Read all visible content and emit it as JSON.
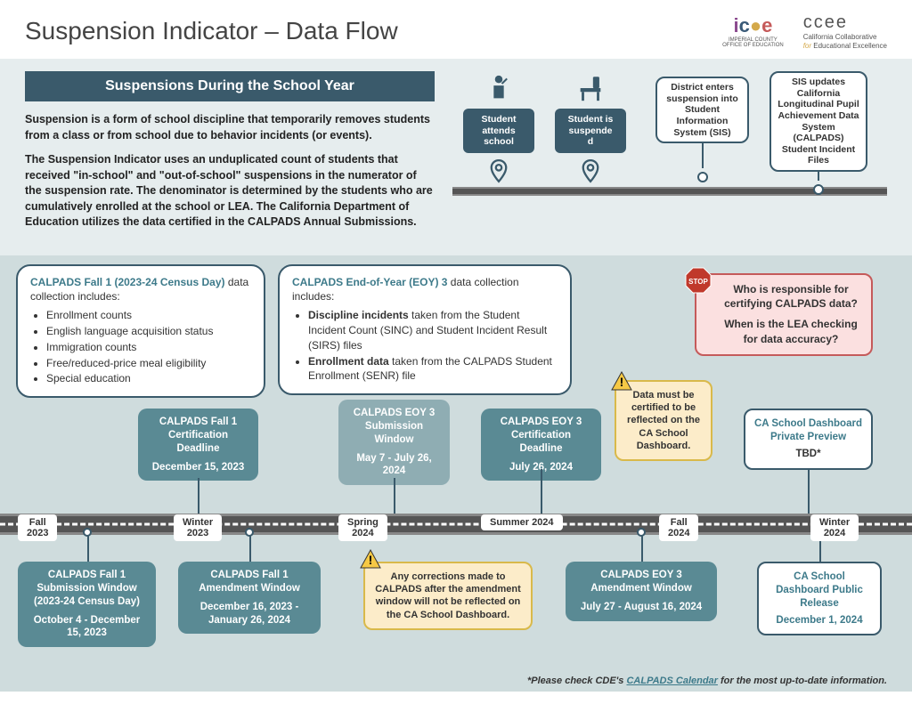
{
  "title": "Suspension Indicator – Data Flow",
  "logos": {
    "icoe_sub": "IMPERIAL COUNTY\nOFFICE OF EDUCATION",
    "ccee_top": "ccee",
    "ccee_sub1": "California Collaborative",
    "ccee_sub2_for": "for",
    "ccee_sub2_rest": " Educational Excellence"
  },
  "banner": "Suspensions During the School Year",
  "para1": "Suspension is a form of school discipline that temporarily removes students from a class or from school due to behavior incidents (or events).",
  "para2": "The Suspension Indicator uses an unduplicated count of students that received \"in-school\" and \"out-of-school\" suspensions in the numerator of the suspension rate. The denominator is determined by the students who are cumulatively enrolled at the school or LEA. The California Department of Education utilizes the data certified in the CALPADS Annual Submissions.",
  "mini": {
    "a": "Student attends school",
    "b": "Student is suspended",
    "c": "District enters suspension into Student Information System (SIS)",
    "d": "SIS updates California Longitudinal Pupil Achievement Data System (CALPADS) Student Incident Files"
  },
  "info1": {
    "hd": "CALPADS Fall 1 (2023-24 Census Day)",
    "tail": " data collection includes:",
    "items": [
      "Enrollment counts",
      "English language acquisition status",
      "Immigration counts",
      "Free/reduced-price meal eligibility",
      "Special education"
    ]
  },
  "info2": {
    "hd": "CALPADS End-of-Year (EOY) 3",
    "tail": " data collection includes:",
    "item1a": "Discipline incidents",
    "item1b": " taken from the Student Incident Count (SINC) and Student Incident Result (SIRS) files",
    "item2a": "Enrollment data",
    "item2b": " taken from the CALPADS Student Enrollment (SENR) file"
  },
  "stop": {
    "label": "STOP",
    "q1": "Who is responsible for certifying CALPADS data?",
    "q2": "When is the LEA checking for data accuracy?"
  },
  "alert_mid": "Data must be certified to be reflected on the\nCA School Dashboard.",
  "alert_low": "Any corrections made to CALPADS after the amendment window will not be reflected on the CA School Dashboard.",
  "seasons": [
    "Fall 2023",
    "Winter 2023",
    "Spring 2024",
    "Summer 2024",
    "Fall 2024",
    "Winter 2024"
  ],
  "boxes": {
    "fall1_cert": {
      "t": "CALPADS Fall 1 Certification Deadline",
      "d": "December 15, 2023"
    },
    "eoy3_win": {
      "t": "CALPADS EOY 3 Submission Window",
      "d": "May 7 - July 26, 2024"
    },
    "eoy3_cert": {
      "t": "CALPADS EOY 3 Certification Deadline",
      "d": "July 26, 2024"
    },
    "preview": {
      "t": "CA School Dashboard Private Preview",
      "d": "TBD*"
    },
    "fall1_sub": {
      "t": "CALPADS Fall 1 Submission Window (2023-24 Census Day)",
      "d": "October 4 - December 15, 2023"
    },
    "fall1_amend": {
      "t": "CALPADS Fall 1 Amendment Window",
      "d": "December 16, 2023 - January 26, 2024"
    },
    "eoy3_amend": {
      "t": "CALPADS EOY 3 Amendment Window",
      "d": "July 27 - August 16, 2024"
    },
    "release": {
      "t": "CA School Dashboard Public Release",
      "d": "December 1, 2024"
    }
  },
  "footnote_pre": "*Please check CDE's ",
  "footnote_link": "CALPADS Calendar",
  "footnote_post": " for the most up-to-date information."
}
